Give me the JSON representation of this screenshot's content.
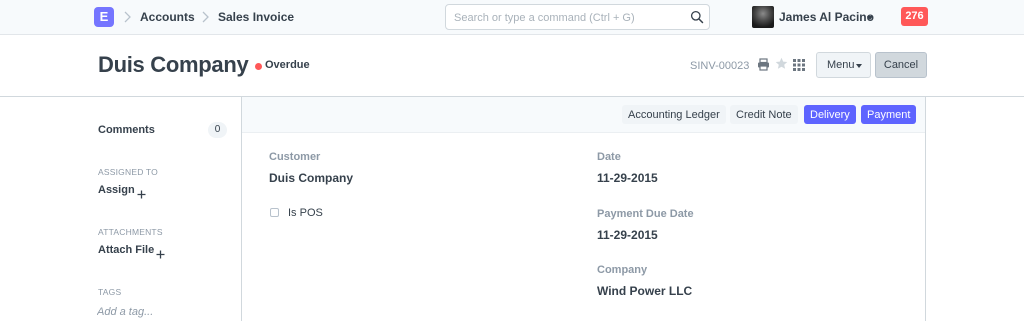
{
  "navbar": {
    "logo_letter": "E",
    "breadcrumbs": [
      "Accounts",
      "Sales Invoice"
    ],
    "search_placeholder": "Search or type a command (Ctrl + G)",
    "user_name": "James Al Pacino",
    "notification_count": "276",
    "notification_color": "#ff5858",
    "brand_color": "#7575ff"
  },
  "page_head": {
    "title": "Duis Company",
    "status": "Overdue",
    "status_color": "#ff5858",
    "doc_id": "SINV-00023",
    "icons": [
      "print-icon",
      "star-icon",
      "grid-icon"
    ],
    "menu_label": "Menu",
    "cancel_label": "Cancel"
  },
  "sidebar": {
    "comments_label": "Comments",
    "comments_count": "0",
    "assigned_to_heading": "ASSIGNED TO",
    "assign_label": "Assign",
    "attachments_heading": "ATTACHMENTS",
    "attach_label": "Attach File",
    "tags_heading": "TAGS",
    "tag_placeholder": "Add a tag..."
  },
  "toolbar": {
    "buttons": [
      {
        "label": "Accounting Ledger",
        "style": "default"
      },
      {
        "label": "Credit Note",
        "style": "default"
      },
      {
        "label": "Delivery",
        "style": "primary"
      },
      {
        "label": "Payment",
        "style": "primary"
      }
    ],
    "primary_color": "#5e64ff"
  },
  "form": {
    "customer_label": "Customer",
    "customer_value": "Duis Company",
    "is_pos_label": "Is POS",
    "is_pos_checked": false,
    "date_label": "Date",
    "date_value": "11-29-2015",
    "due_date_label": "Payment Due Date",
    "due_date_value": "11-29-2015",
    "company_label": "Company",
    "company_value": "Wind Power LLC"
  }
}
